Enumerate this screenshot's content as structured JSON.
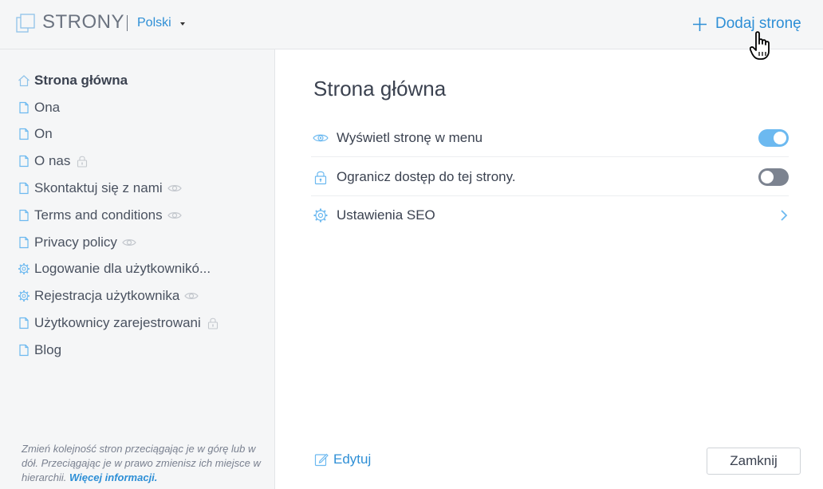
{
  "header": {
    "title": "STRONY",
    "language": "Polski",
    "add_page_label": "Dodaj stronę"
  },
  "sidebar": {
    "pages": [
      {
        "label": "Strona główna",
        "icon": "home-icon",
        "badge": null,
        "active": true
      },
      {
        "label": "Ona",
        "icon": "page-icon",
        "badge": null
      },
      {
        "label": "On",
        "icon": "page-icon",
        "badge": null
      },
      {
        "label": "O nas",
        "icon": "page-icon",
        "badge": "lock-icon"
      },
      {
        "label": "Skontaktuj się z nami",
        "icon": "page-icon",
        "badge": "eye-icon"
      },
      {
        "label": "Terms and conditions",
        "icon": "page-icon",
        "badge": "eye-icon"
      },
      {
        "label": "Privacy policy",
        "icon": "page-icon",
        "badge": "eye-icon"
      },
      {
        "label": "Logowanie dla użytkownikó...",
        "icon": "gear-icon",
        "badge": null
      },
      {
        "label": "Rejestracja użytkownika",
        "icon": "gear-icon",
        "badge": "eye-icon"
      },
      {
        "label": "Użytkownicy zarejestrowani",
        "icon": "page-icon",
        "badge": "lock-icon"
      },
      {
        "label": "Blog",
        "icon": "page-icon",
        "badge": null
      }
    ],
    "hint_text": "Zmień kolejność stron przeciągając je w górę lub w dół. Przeciągając je w prawo zmienisz ich miejsce w hierarchii.",
    "hint_link": "Więcej informacji."
  },
  "main": {
    "page_title": "Strona główna",
    "settings": [
      {
        "label": "Wyświetl stronę w menu",
        "icon": "eye-icon",
        "control": "toggle",
        "value": "on"
      },
      {
        "label": "Ogranicz dostęp do tej strony.",
        "icon": "lock-icon",
        "control": "toggle",
        "value": "off"
      },
      {
        "label": "Ustawienia SEO",
        "icon": "gear-icon",
        "control": "chevron"
      }
    ],
    "edit_label": "Edytuj",
    "close_label": "Zamknij"
  },
  "colors": {
    "accent": "#2e8fd6",
    "toggle_on": "#6cb9f0",
    "toggle_off": "#7c8390",
    "sidebar_bg": "#f5f6f7",
    "text": "#3b4250"
  }
}
